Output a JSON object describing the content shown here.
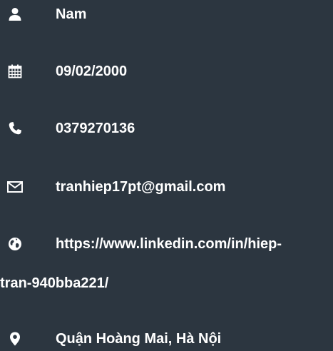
{
  "profile": {
    "name": {
      "icon": "user-icon",
      "value": "Nam"
    },
    "birthdate": {
      "icon": "calendar-icon",
      "value": "09/02/2000"
    },
    "phone": {
      "icon": "phone-icon",
      "value": "0379270136"
    },
    "email": {
      "icon": "envelope-icon",
      "value": "tranhiep17pt@gmail.com"
    },
    "website": {
      "icon": "globe-icon",
      "value_line1": "https://www.linkedin.com/in/hiep-",
      "value_line2": "tran-940bba221/"
    },
    "address": {
      "icon": "map-marker-icon",
      "value": "Quận Hoàng Mai, Hà Nội"
    }
  },
  "colors": {
    "background": "#2c3640",
    "text": "#ffffff"
  }
}
